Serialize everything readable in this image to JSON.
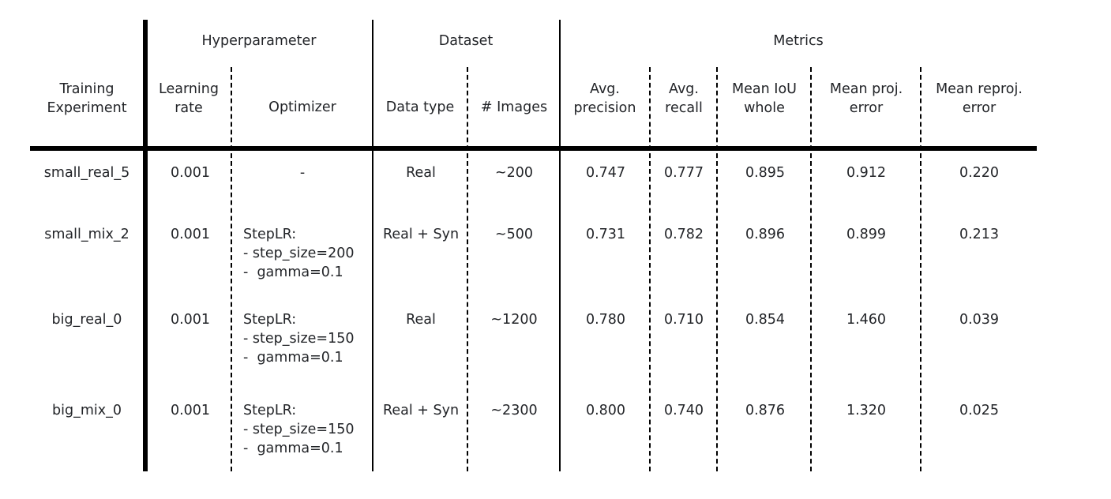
{
  "table": {
    "groups": {
      "hyperparameter": "Hyperparameter",
      "dataset": "Dataset",
      "metrics": "Metrics"
    },
    "headers": {
      "experiment": [
        "Training",
        "Experiment"
      ],
      "learning_rate": [
        "Learning",
        "rate"
      ],
      "optimizer": [
        "Optimizer"
      ],
      "data_type": [
        "Data type"
      ],
      "images": [
        "# Images"
      ],
      "avg_precision": [
        "Avg.",
        "precision"
      ],
      "avg_recall": [
        "Avg.",
        "recall"
      ],
      "mean_iou": [
        "Mean IoU",
        "whole"
      ],
      "mean_proj_error": [
        "Mean proj.",
        "error"
      ],
      "mean_reproj_error": [
        "Mean reproj.",
        "error"
      ]
    },
    "rows": [
      {
        "experiment": "small_real_5",
        "learning_rate": "0.001",
        "optimizer": [
          "-"
        ],
        "data_type": "Real",
        "images": "~200",
        "avg_precision": "0.747",
        "avg_recall": "0.777",
        "mean_iou": "0.895",
        "mean_proj_error": "0.912",
        "mean_reproj_error": "0.220"
      },
      {
        "experiment": "small_mix_2",
        "learning_rate": "0.001",
        "optimizer": [
          "StepLR:",
          "- step_size=200",
          "-  gamma=0.1"
        ],
        "data_type": "Real + Syn",
        "images": "~500",
        "avg_precision": "0.731",
        "avg_recall": "0.782",
        "mean_iou": "0.896",
        "mean_proj_error": "0.899",
        "mean_reproj_error": "0.213"
      },
      {
        "experiment": "big_real_0",
        "learning_rate": "0.001",
        "optimizer": [
          "StepLR:",
          "- step_size=150",
          "-  gamma=0.1"
        ],
        "data_type": "Real",
        "images": "~1200",
        "avg_precision": "0.780",
        "avg_recall": "0.710",
        "mean_iou": "0.854",
        "mean_proj_error": "1.460",
        "mean_reproj_error": "0.039"
      },
      {
        "experiment": "big_mix_0",
        "learning_rate": "0.001",
        "optimizer": [
          "StepLR:",
          "- step_size=150",
          "-  gamma=0.1"
        ],
        "data_type": "Real + Syn",
        "images": "~2300",
        "avg_precision": "0.800",
        "avg_recall": "0.740",
        "mean_iou": "0.876",
        "mean_proj_error": "1.320",
        "mean_reproj_error": "0.025"
      }
    ]
  }
}
